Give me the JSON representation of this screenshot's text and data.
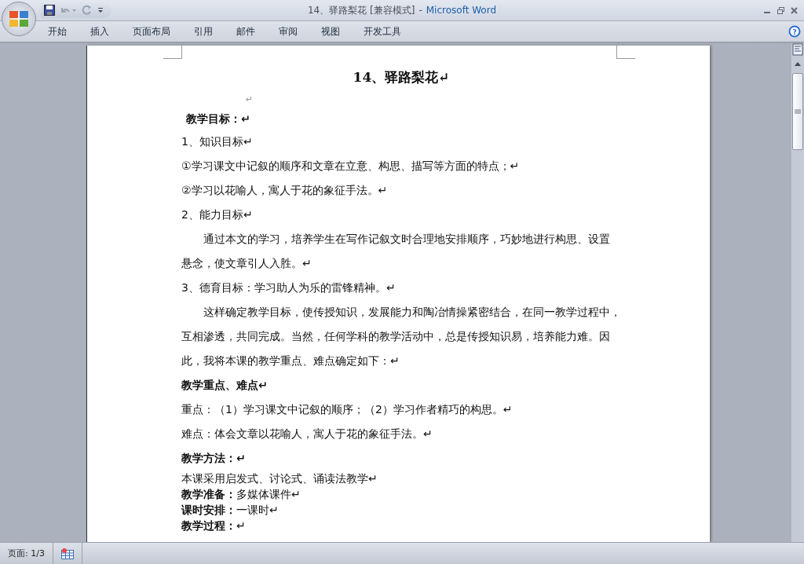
{
  "window": {
    "document_title": "14、驿路梨花 [兼容模式]",
    "separator": "-",
    "app_name": "Microsoft Word"
  },
  "tabs": [
    {
      "label": "开始",
      "selected": false
    },
    {
      "label": "插入",
      "selected": false
    },
    {
      "label": "页面布局",
      "selected": false
    },
    {
      "label": "引用",
      "selected": false
    },
    {
      "label": "邮件",
      "selected": false
    },
    {
      "label": "审阅",
      "selected": false
    },
    {
      "label": "视图",
      "selected": false
    },
    {
      "label": "开发工具",
      "selected": false
    }
  ],
  "document": {
    "paragraphs": [
      {
        "kind": "title",
        "lines": [
          "14、驿路梨花↵"
        ]
      },
      {
        "kind": "blank",
        "lines": [
          "↵"
        ]
      },
      {
        "kind": "heading",
        "lines": [
          "教学目标：↵"
        ]
      },
      {
        "kind": "text",
        "lines": [
          "1、知识目标↵"
        ]
      },
      {
        "kind": "text",
        "lines": [
          "①学习课文中记叙的顺序和文章在立意、构思、描写等方面的特点；↵"
        ]
      },
      {
        "kind": "text",
        "lines": [
          "②学习以花喻人，寓人于花的象征手法。↵"
        ]
      },
      {
        "kind": "text",
        "lines": [
          "2、能力目标↵"
        ]
      },
      {
        "kind": "indent",
        "lines": [
          "通过本文的学习，培养学生在写作记叙文时合理地安排顺序，巧妙地进行构思、设置",
          "悬念，使文章引人入胜。↵"
        ]
      },
      {
        "kind": "text",
        "lines": [
          "3、德育目标：学习助人为乐的雷锋精神。↵"
        ]
      },
      {
        "kind": "indent",
        "lines": [
          "这样确定教学目标，使传授知识，发展能力和陶冶情操紧密结合，在同一教学过程中，",
          "互相渗透，共同完成。当然，任何学科的教学活动中，总是传授知识易，培养能力难。因",
          "此，我将本课的教学重点、难点确定如下：↵"
        ]
      },
      {
        "kind": "heading",
        "lines": [
          "教学重点、难点↵"
        ]
      },
      {
        "kind": "text",
        "lines": [
          "重点：（1）学习课文中记叙的顺序；（2）学习作者精巧的构思。↵"
        ]
      },
      {
        "kind": "text",
        "lines": [
          "难点：体会文章以花喻人，寓人于花的象征手法。↵"
        ]
      },
      {
        "kind": "heading",
        "lines": [
          "教学方法：↵"
        ]
      },
      {
        "kind": "compact",
        "lines": [
          "本课采用启发式、讨论式、诵读法教学↵"
        ]
      },
      {
        "kind": "compact",
        "lines": [
          "**教学准备：**多媒体课件↵"
        ]
      },
      {
        "kind": "compact",
        "lines": [
          "**课时安排：**一课时↵"
        ]
      },
      {
        "kind": "compact",
        "lines": [
          "**教学过程：**↵"
        ]
      }
    ]
  },
  "help_button": "?",
  "status_bar": {
    "page": "页面: 1/3"
  }
}
